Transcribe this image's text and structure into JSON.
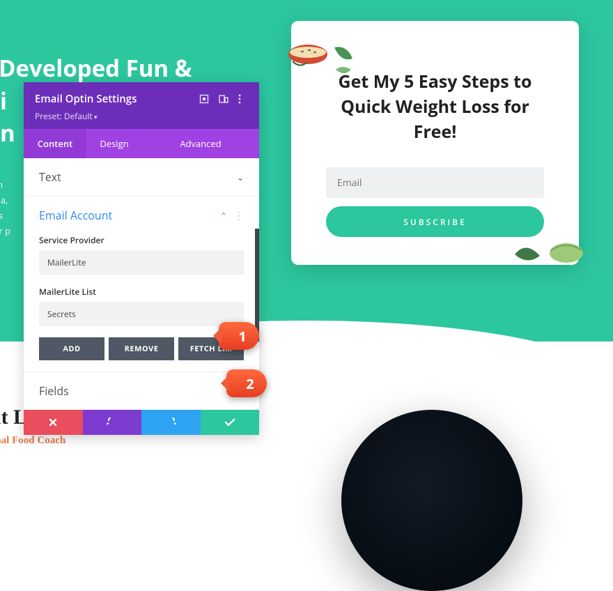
{
  "hero": {
    "title_line1": "e Developed Fun &",
    "title_line2": "ali",
    "title_line3": "lan",
    "para_l1": "psum",
    "para_l2": "s urna,",
    "para_l3": "s felis",
    "para_l4": "orper p"
  },
  "about": {
    "heading": "out Lindsay",
    "subheading": "ssional Food Coach"
  },
  "optin_card": {
    "heading_l1": "Get My 5 Easy Steps to",
    "heading_l2": "Quick Weight Loss for Free!",
    "email_placeholder": "Email",
    "subscribe_label": "SUBSCRIBE"
  },
  "panel": {
    "title": "Email Optin Settings",
    "preset": "Preset: Default",
    "tabs": {
      "content": "Content",
      "design": "Design",
      "advanced": "Advanced"
    },
    "sections": {
      "text": "Text",
      "email_account": "Email Account",
      "fields": "Fields"
    },
    "email_account": {
      "provider_label": "Service Provider",
      "provider_value": "MailerLite",
      "list_label": "MailerLite List",
      "list_value": "Secrets",
      "add": "ADD",
      "remove": "REMOVE",
      "fetch": "FETCH LI…"
    },
    "header_icons": [
      "focus-icon",
      "responsive-icon",
      "more-icon"
    ],
    "footer_icons": [
      "close-icon",
      "undo-icon",
      "redo-icon",
      "save-check-icon"
    ]
  },
  "annotations": {
    "one": "1",
    "two": "2"
  },
  "colors": {
    "brand_green": "#2cc69f",
    "purple_dark": "#6c2eb9",
    "purple_light": "#a042e3",
    "accent_blue": "#2ea3f2",
    "danger": "#ea4d5e"
  }
}
